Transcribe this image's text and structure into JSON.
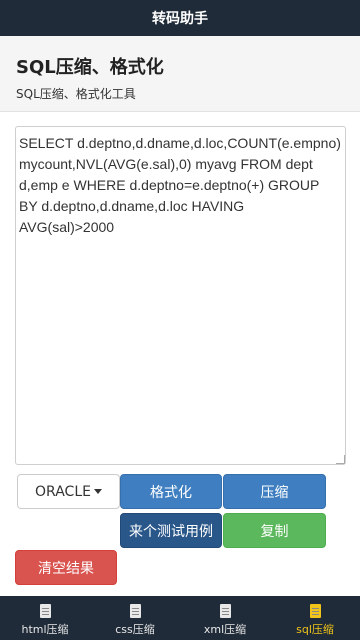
{
  "app": {
    "title": "转码助手"
  },
  "header": {
    "title": "SQL压缩、格式化",
    "subtitle": "SQL压缩、格式化工具"
  },
  "editor": {
    "value": "SELECT d.deptno,d.dname,d.loc,COUNT(e.empno) mycount,NVL(AVG(e.sal),0) myavg FROM dept d,emp e WHERE d.deptno=e.deptno(+) GROUP BY d.deptno,d.dname,d.loc HAVING AVG(sal)>2000"
  },
  "buttons": {
    "dialect": "ORACLE",
    "format": "格式化",
    "compress": "压缩",
    "sample": "来个测试用例",
    "copy": "复制",
    "clear": "清空结果"
  },
  "tabs": [
    {
      "label": "html压缩",
      "icon": "file-code-icon",
      "active": false
    },
    {
      "label": "css压缩",
      "icon": "file-code-icon",
      "active": false
    },
    {
      "label": "xml压缩",
      "icon": "file-code-icon",
      "active": false
    },
    {
      "label": "sql压缩",
      "icon": "sql-file-icon",
      "active": true
    }
  ],
  "colors": {
    "topbar": "#1f2b38",
    "primary": "#3f7fc1",
    "dark_primary": "#29578a",
    "success": "#5cb85c",
    "danger": "#d9534f",
    "active_tab": "#f0c419"
  }
}
